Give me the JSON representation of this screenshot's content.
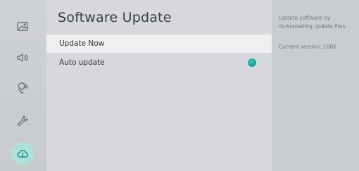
{
  "sidebar": {
    "items": [
      {
        "icon": "picture-icon",
        "name": "sidebar-item-picture"
      },
      {
        "icon": "sound-icon",
        "name": "sidebar-item-sound"
      },
      {
        "icon": "broadcasting-icon",
        "name": "sidebar-item-broadcasting"
      },
      {
        "icon": "wrench-icon",
        "name": "sidebar-item-general"
      },
      {
        "icon": "support-cloud-icon",
        "name": "sidebar-item-support",
        "active": true
      }
    ]
  },
  "main": {
    "title": "Software Update",
    "items": [
      {
        "label": "Update Now",
        "selected": true
      },
      {
        "label": "Auto update",
        "toggle": "on"
      }
    ]
  },
  "info": {
    "description": "Update software by downloading update files.",
    "version": "Current version: 1006"
  },
  "colors": {
    "accent": "#1b9a90",
    "active_bg": "#aee0dc"
  }
}
